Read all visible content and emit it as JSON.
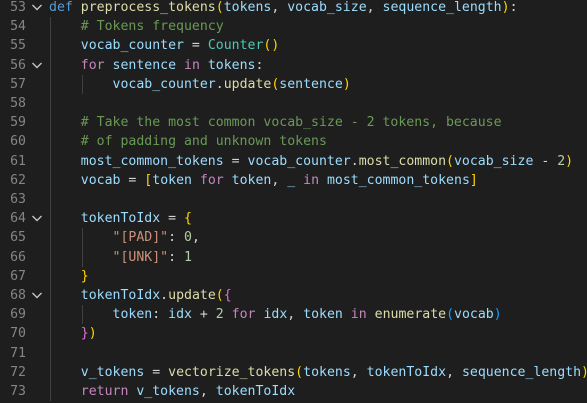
{
  "editor": {
    "colors": {
      "background": "#1e1e1e",
      "line_number": "#858585",
      "keyword": "#569cd6",
      "control": "#c586c0",
      "function": "#dcdcaa",
      "variable": "#9cdcfe",
      "class": "#4ec9b0",
      "string": "#ce9178",
      "number": "#b5cea8",
      "comment": "#6a9955",
      "bracket_1": "#ffd700",
      "bracket_2": "#da70d6",
      "bracket_3": "#179fff"
    },
    "lines": [
      {
        "number": "53",
        "fold": true,
        "tokens": [
          {
            "t": "kw",
            "v": "def "
          },
          {
            "t": "fn",
            "v": "preprocess_tokens"
          },
          {
            "t": "b1",
            "v": "("
          },
          {
            "t": "var",
            "v": "tokens"
          },
          {
            "t": "op",
            "v": ", "
          },
          {
            "t": "var",
            "v": "vocab_size"
          },
          {
            "t": "op",
            "v": ", "
          },
          {
            "t": "var",
            "v": "sequence_length"
          },
          {
            "t": "b1",
            "v": ")"
          },
          {
            "t": "op",
            "v": ":"
          }
        ]
      },
      {
        "number": "54",
        "fold": false,
        "tokens": [
          {
            "t": "op",
            "v": "    "
          },
          {
            "t": "cmt",
            "v": "# Tokens frequency"
          }
        ]
      },
      {
        "number": "55",
        "fold": false,
        "tokens": [
          {
            "t": "op",
            "v": "    "
          },
          {
            "t": "var",
            "v": "vocab_counter"
          },
          {
            "t": "op",
            "v": " = "
          },
          {
            "t": "cls",
            "v": "Counter"
          },
          {
            "t": "b1",
            "v": "()"
          }
        ]
      },
      {
        "number": "56",
        "fold": true,
        "tokens": [
          {
            "t": "op",
            "v": "    "
          },
          {
            "t": "ctl",
            "v": "for "
          },
          {
            "t": "var",
            "v": "sentence"
          },
          {
            "t": "ctl",
            "v": " in "
          },
          {
            "t": "var",
            "v": "tokens"
          },
          {
            "t": "op",
            "v": ":"
          }
        ]
      },
      {
        "number": "57",
        "fold": false,
        "tokens": [
          {
            "t": "op",
            "v": "        "
          },
          {
            "t": "var",
            "v": "vocab_counter"
          },
          {
            "t": "op",
            "v": "."
          },
          {
            "t": "fn",
            "v": "update"
          },
          {
            "t": "b1",
            "v": "("
          },
          {
            "t": "var",
            "v": "sentence"
          },
          {
            "t": "b1",
            "v": ")"
          }
        ]
      },
      {
        "number": "58",
        "fold": false,
        "tokens": []
      },
      {
        "number": "59",
        "fold": false,
        "tokens": [
          {
            "t": "op",
            "v": "    "
          },
          {
            "t": "cmt",
            "v": "# Take the most common vocab_size - 2 tokens, because"
          }
        ]
      },
      {
        "number": "60",
        "fold": false,
        "tokens": [
          {
            "t": "op",
            "v": "    "
          },
          {
            "t": "cmt",
            "v": "# of padding and unknown tokens"
          }
        ]
      },
      {
        "number": "61",
        "fold": false,
        "tokens": [
          {
            "t": "op",
            "v": "    "
          },
          {
            "t": "var",
            "v": "most_common_tokens"
          },
          {
            "t": "op",
            "v": " = "
          },
          {
            "t": "var",
            "v": "vocab_counter"
          },
          {
            "t": "op",
            "v": "."
          },
          {
            "t": "fn",
            "v": "most_common"
          },
          {
            "t": "b1",
            "v": "("
          },
          {
            "t": "var",
            "v": "vocab_size"
          },
          {
            "t": "op",
            "v": " - "
          },
          {
            "t": "num",
            "v": "2"
          },
          {
            "t": "b1",
            "v": ")"
          }
        ]
      },
      {
        "number": "62",
        "fold": false,
        "tokens": [
          {
            "t": "op",
            "v": "    "
          },
          {
            "t": "var",
            "v": "vocab"
          },
          {
            "t": "op",
            "v": " = "
          },
          {
            "t": "b1",
            "v": "["
          },
          {
            "t": "var",
            "v": "token"
          },
          {
            "t": "ctl",
            "v": " for "
          },
          {
            "t": "var",
            "v": "token"
          },
          {
            "t": "op",
            "v": ", "
          },
          {
            "t": "var",
            "v": "_"
          },
          {
            "t": "ctl",
            "v": " in "
          },
          {
            "t": "var",
            "v": "most_common_tokens"
          },
          {
            "t": "b1",
            "v": "]"
          }
        ]
      },
      {
        "number": "63",
        "fold": false,
        "tokens": []
      },
      {
        "number": "64",
        "fold": true,
        "tokens": [
          {
            "t": "op",
            "v": "    "
          },
          {
            "t": "var",
            "v": "tokenToIdx"
          },
          {
            "t": "op",
            "v": " = "
          },
          {
            "t": "b1",
            "v": "{"
          }
        ]
      },
      {
        "number": "65",
        "fold": false,
        "tokens": [
          {
            "t": "op",
            "v": "        "
          },
          {
            "t": "str",
            "v": "\"[PAD]\""
          },
          {
            "t": "op",
            "v": ": "
          },
          {
            "t": "num",
            "v": "0"
          },
          {
            "t": "op",
            "v": ","
          }
        ]
      },
      {
        "number": "66",
        "fold": false,
        "tokens": [
          {
            "t": "op",
            "v": "        "
          },
          {
            "t": "str",
            "v": "\"[UNK]\""
          },
          {
            "t": "op",
            "v": ": "
          },
          {
            "t": "num",
            "v": "1"
          }
        ]
      },
      {
        "number": "67",
        "fold": false,
        "tokens": [
          {
            "t": "op",
            "v": "    "
          },
          {
            "t": "b1",
            "v": "}"
          }
        ]
      },
      {
        "number": "68",
        "fold": true,
        "tokens": [
          {
            "t": "op",
            "v": "    "
          },
          {
            "t": "var",
            "v": "tokenToIdx"
          },
          {
            "t": "op",
            "v": "."
          },
          {
            "t": "fn",
            "v": "update"
          },
          {
            "t": "b1",
            "v": "("
          },
          {
            "t": "b2",
            "v": "{"
          }
        ]
      },
      {
        "number": "69",
        "fold": false,
        "tokens": [
          {
            "t": "op",
            "v": "        "
          },
          {
            "t": "var",
            "v": "token"
          },
          {
            "t": "op",
            "v": ": "
          },
          {
            "t": "var",
            "v": "idx"
          },
          {
            "t": "op",
            "v": " + "
          },
          {
            "t": "num",
            "v": "2"
          },
          {
            "t": "ctl",
            "v": " for "
          },
          {
            "t": "var",
            "v": "idx"
          },
          {
            "t": "op",
            "v": ", "
          },
          {
            "t": "var",
            "v": "token"
          },
          {
            "t": "ctl",
            "v": " in "
          },
          {
            "t": "fn",
            "v": "enumerate"
          },
          {
            "t": "b3",
            "v": "("
          },
          {
            "t": "var",
            "v": "vocab"
          },
          {
            "t": "b3",
            "v": ")"
          }
        ]
      },
      {
        "number": "70",
        "fold": false,
        "tokens": [
          {
            "t": "op",
            "v": "    "
          },
          {
            "t": "b2",
            "v": "}"
          },
          {
            "t": "b1",
            "v": ")"
          }
        ]
      },
      {
        "number": "71",
        "fold": false,
        "tokens": []
      },
      {
        "number": "72",
        "fold": false,
        "tokens": [
          {
            "t": "op",
            "v": "    "
          },
          {
            "t": "var",
            "v": "v_tokens"
          },
          {
            "t": "op",
            "v": " = "
          },
          {
            "t": "fn",
            "v": "vectorize_tokens"
          },
          {
            "t": "b1",
            "v": "("
          },
          {
            "t": "var",
            "v": "tokens"
          },
          {
            "t": "op",
            "v": ", "
          },
          {
            "t": "var",
            "v": "tokenToIdx"
          },
          {
            "t": "op",
            "v": ", "
          },
          {
            "t": "var",
            "v": "sequence_length"
          },
          {
            "t": "b1",
            "v": ")"
          }
        ]
      },
      {
        "number": "73",
        "fold": false,
        "tokens": [
          {
            "t": "op",
            "v": "    "
          },
          {
            "t": "ctl",
            "v": "return "
          },
          {
            "t": "var",
            "v": "v_tokens"
          },
          {
            "t": "op",
            "v": ", "
          },
          {
            "t": "var",
            "v": "tokenToIdx"
          }
        ]
      }
    ]
  }
}
